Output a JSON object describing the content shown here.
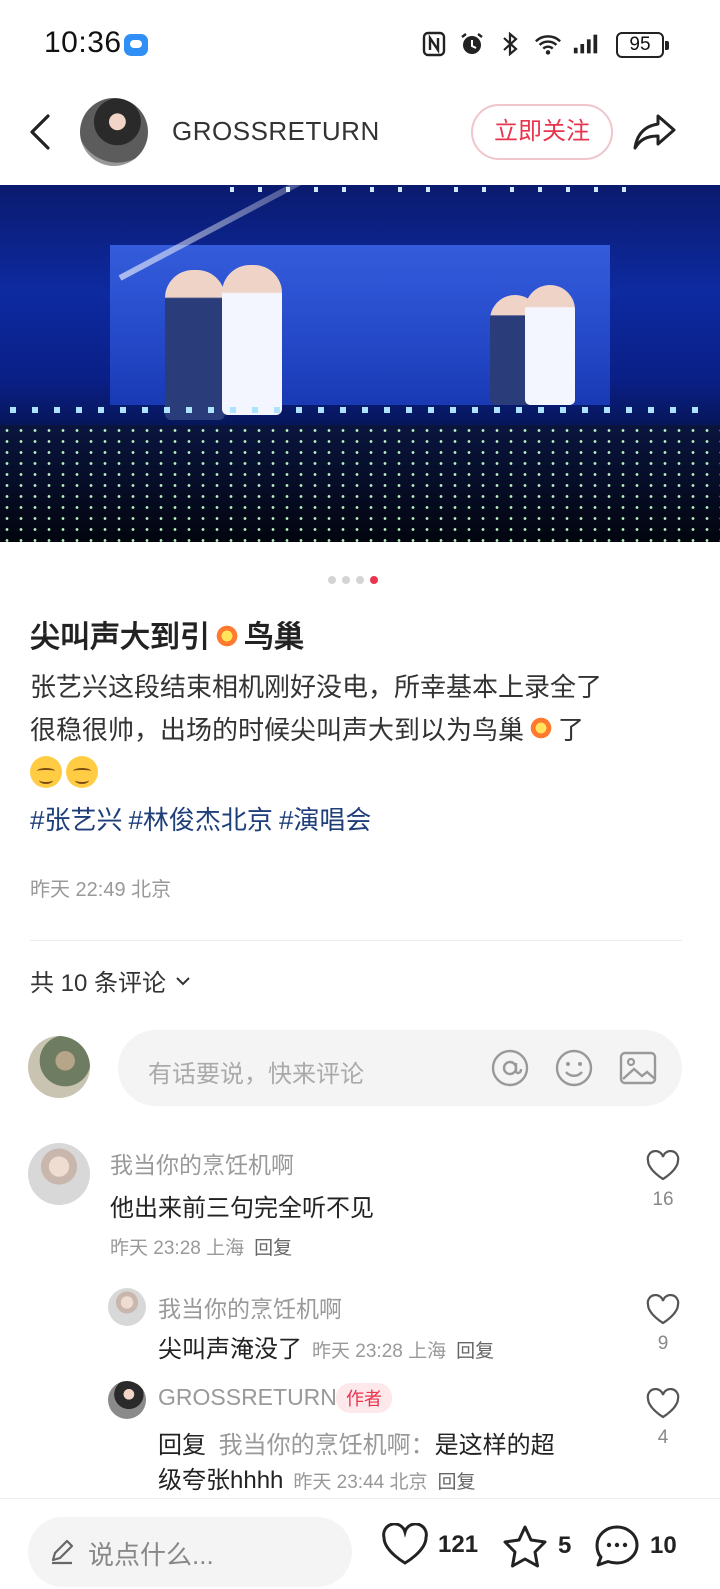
{
  "status_bar": {
    "time": "10:36",
    "battery": "95",
    "icons": [
      "nfc-icon",
      "alarm-icon",
      "bluetooth-icon",
      "wifi-icon",
      "signal-icon",
      "battery-icon"
    ]
  },
  "header": {
    "author_name": "GROSSRETURN",
    "follow_label": "立即关注"
  },
  "carousel": {
    "total": 4,
    "active_index": 3
  },
  "post": {
    "title_before": "尖叫声大到引",
    "title_after": "鸟巢",
    "body_line1": "张艺兴这段结束相机刚好没电，所幸基本上录全了",
    "body_line2_before": "很稳很帅，出场的时候尖叫声大到以为鸟巢",
    "body_line2_after": "了",
    "hashtags": [
      "#张艺兴",
      "#林俊杰北京",
      "#演唱会"
    ],
    "meta": "昨天 22:49 北京"
  },
  "comments_header": {
    "label": "共 10 条评论"
  },
  "comment_input": {
    "placeholder": "有话要说，快来评论"
  },
  "comments": [
    {
      "name": "我当你的烹饪机啊",
      "text": "他出来前三句完全听不见",
      "time_loc": "昨天 23:28 上海",
      "reply_label": "回复",
      "likes": "16"
    },
    {
      "name": "我当你的烹饪机啊",
      "text": "尖叫声淹没了",
      "time_loc": "昨天 23:28 上海",
      "reply_label": "回复",
      "likes": "9"
    },
    {
      "name": "GROSSRETURN",
      "author_tag": "作者",
      "text_line1_prefix": "回复",
      "text_line1_target": "我当你的烹饪机啊：",
      "text_line1_rest": "是这样的超",
      "text_line2": "级夸张hhhh",
      "time_loc": "昨天 23:44 北京",
      "reply_label": "回复",
      "likes": "4"
    }
  ],
  "bottom_bar": {
    "input_placeholder": "说点什么...",
    "likes": "121",
    "stars": "5",
    "comments": "10"
  },
  "colors": {
    "accent": "#e8344e",
    "hashtag": "#1f3f7a"
  }
}
